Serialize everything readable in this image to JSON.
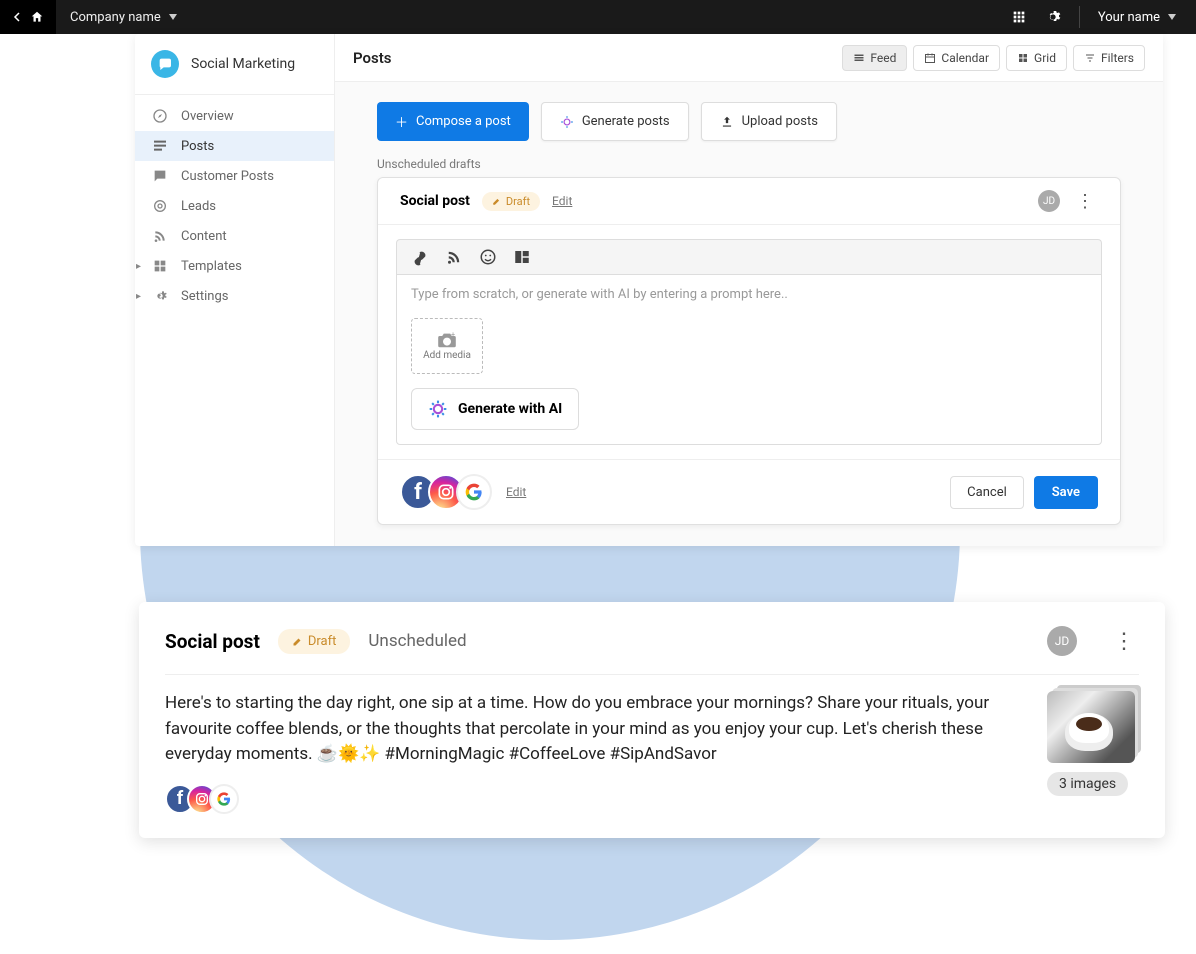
{
  "topbar": {
    "company_label": "Company name",
    "user_label": "Your name"
  },
  "sidebar": {
    "app_name": "Social Marketing",
    "items": [
      {
        "label": "Overview"
      },
      {
        "label": "Posts"
      },
      {
        "label": "Customer Posts"
      },
      {
        "label": "Leads"
      },
      {
        "label": "Content"
      },
      {
        "label": "Templates"
      },
      {
        "label": "Settings"
      }
    ]
  },
  "header": {
    "title": "Posts",
    "views": {
      "feed": "Feed",
      "calendar": "Calendar",
      "grid": "Grid",
      "filters": "Filters"
    }
  },
  "actions": {
    "compose": "Compose a post",
    "generate": "Generate posts",
    "upload": "Upload posts"
  },
  "section_label": "Unscheduled drafts",
  "editor": {
    "title": "Social post",
    "draft_label": "Draft",
    "edit_label": "Edit",
    "avatar": "JD",
    "placeholder": "Type from scratch, or generate with AI by entering a prompt here..",
    "add_media": "Add media",
    "gen_ai": "Generate with AI",
    "cancel": "Cancel",
    "save": "Save",
    "networks_edit": "Edit"
  },
  "preview": {
    "title": "Social post",
    "draft_label": "Draft",
    "unscheduled": "Unscheduled",
    "avatar": "JD",
    "body": "Here's to starting the day right, one sip at a time. How do you embrace your mornings? Share your rituals, your favourite coffee blends, or the thoughts that percolate in your mind as you enjoy your cup. Let's cherish these everyday moments. ☕🌞✨ #MorningMagic #CoffeeLove #SipAndSavor",
    "image_badge": "3 images"
  }
}
